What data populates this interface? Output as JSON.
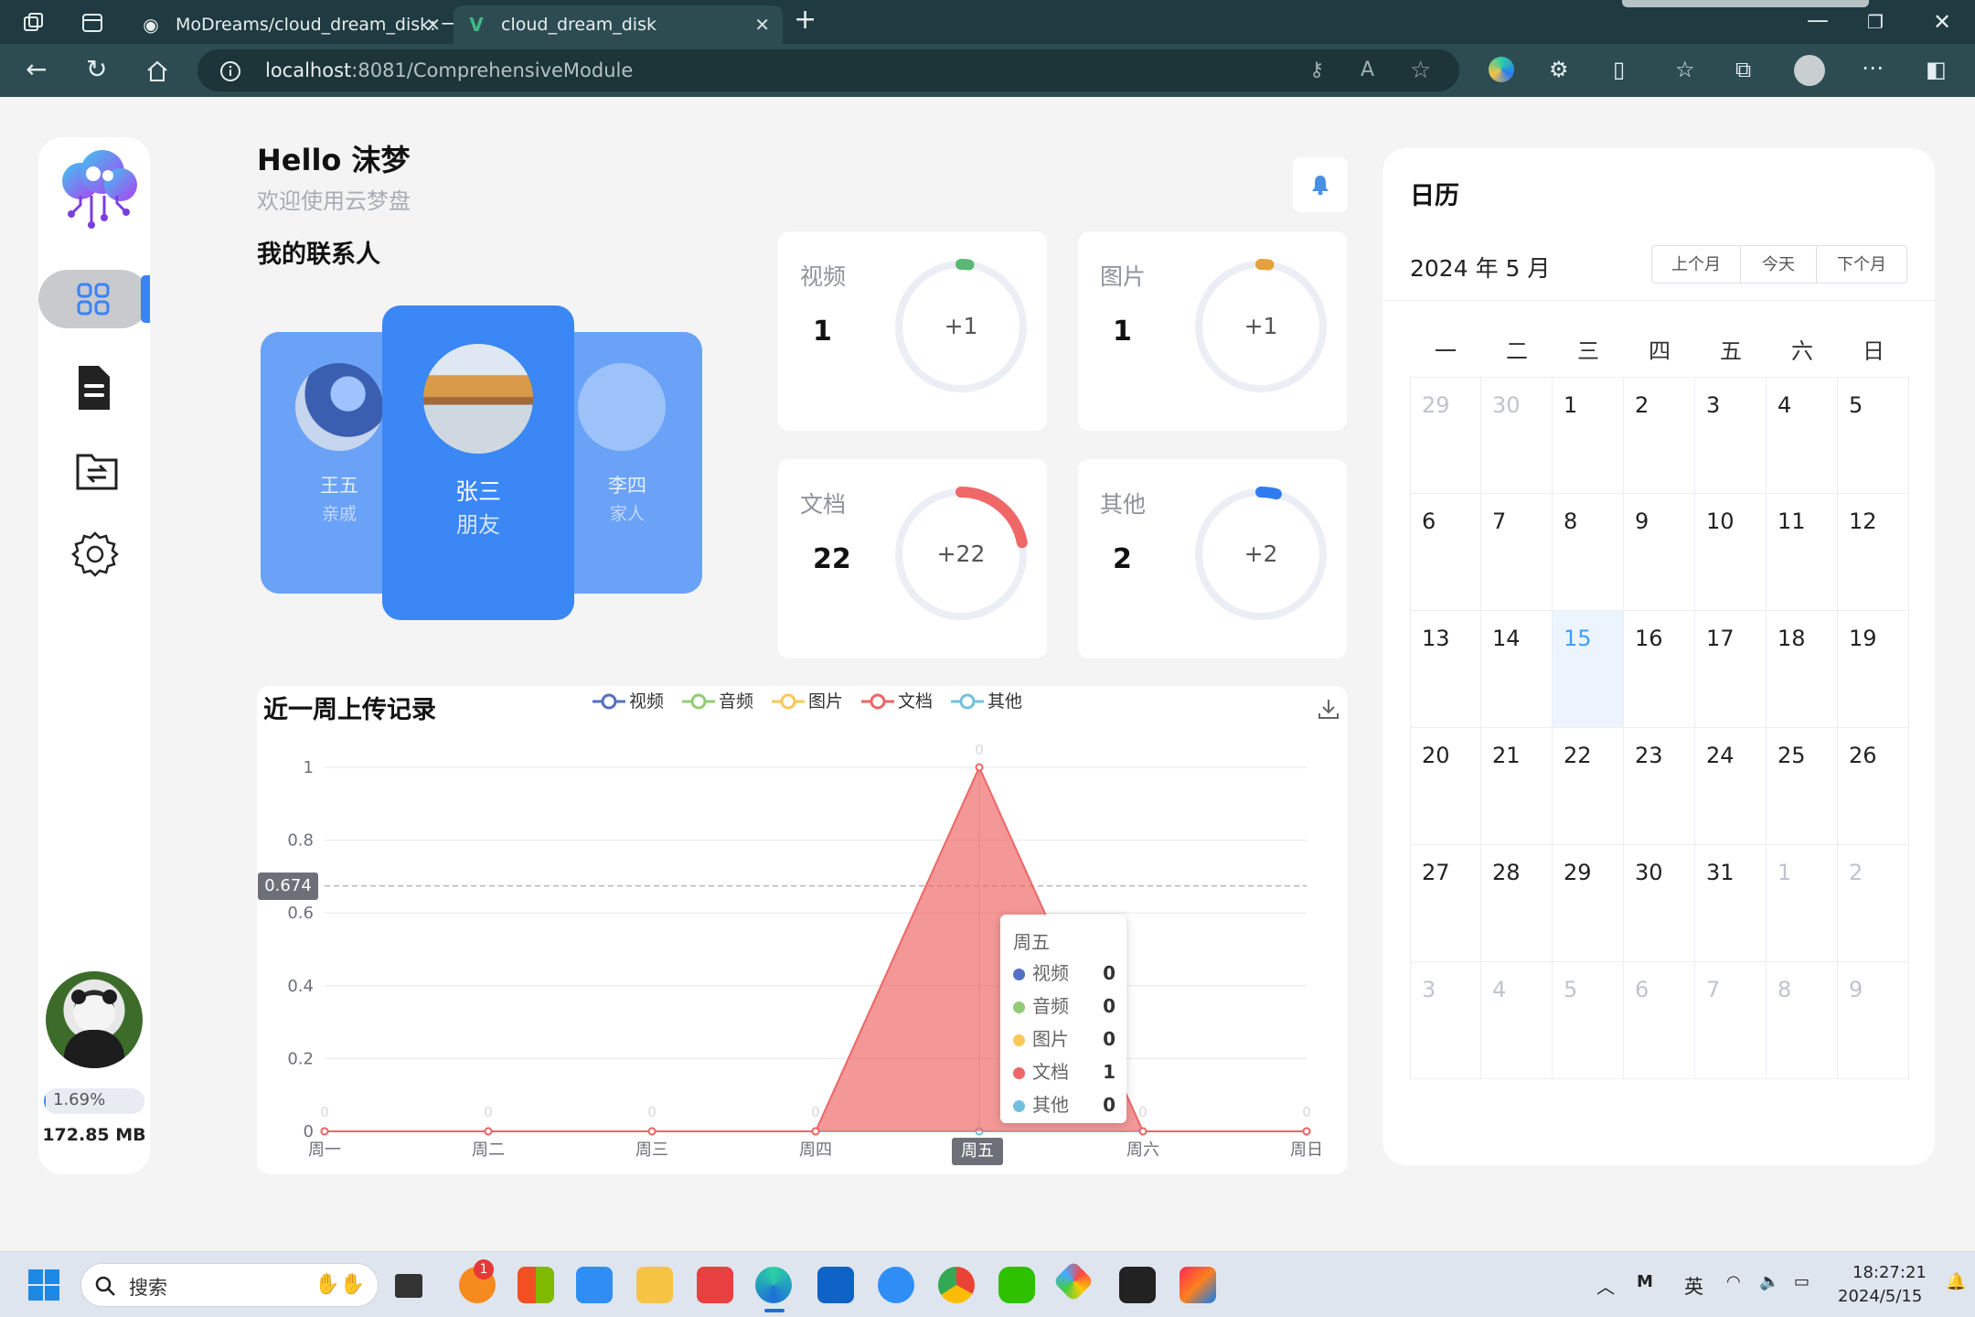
{
  "browser": {
    "tabs": [
      {
        "title": "MoDreams/cloud_dream_disk: 一",
        "active": false
      },
      {
        "title": "cloud_dream_disk",
        "active": true
      }
    ],
    "url_host": "localhost",
    "url_path": ":8081/ComprehensiveModule"
  },
  "header": {
    "greeting": "Hello 沫梦",
    "subtitle": "欢迎使用云梦盘"
  },
  "contacts": {
    "title": "我的联系人",
    "items": [
      {
        "name": "王五",
        "relation": "亲戚"
      },
      {
        "name": "张三",
        "relation": "朋友"
      },
      {
        "name": "李四",
        "relation": "家人"
      }
    ]
  },
  "stats": [
    {
      "label": "视频",
      "count": "1",
      "increment": "+1",
      "ratio": 0.02,
      "color": "#5ab874"
    },
    {
      "label": "图片",
      "count": "1",
      "increment": "+1",
      "ratio": 0.02,
      "color": "#e5a23c"
    },
    {
      "label": "文档",
      "count": "22",
      "increment": "+22",
      "ratio": 0.22,
      "color": "#ef6767"
    },
    {
      "label": "其他",
      "count": "2",
      "increment": "+2",
      "ratio": 0.04,
      "color": "#2f7cf0"
    }
  ],
  "sidebar": {
    "storage_percent": "1.69%",
    "storage_used": "172.85 MB",
    "storage_ratio": 0.0169
  },
  "chart_data": {
    "type": "area",
    "title": "近一周上传记录",
    "categories": [
      "周一",
      "周二",
      "周三",
      "周四",
      "周五",
      "周六",
      "周日"
    ],
    "y_ticks": [
      "0",
      "0.2",
      "0.4",
      "0.6",
      "0.8",
      "1"
    ],
    "ylim": [
      0,
      1
    ],
    "series": [
      {
        "name": "视频",
        "color": "#5470c6",
        "values": [
          0,
          0,
          0,
          0,
          0,
          0,
          0
        ]
      },
      {
        "name": "音频",
        "color": "#91cc75",
        "values": [
          0,
          0,
          0,
          0,
          0,
          0,
          0
        ]
      },
      {
        "name": "图片",
        "color": "#fac858",
        "values": [
          0,
          0,
          0,
          0,
          0,
          0,
          0
        ]
      },
      {
        "name": "文档",
        "color": "#ee6666",
        "values": [
          0,
          0,
          0,
          0,
          1,
          0,
          0
        ]
      },
      {
        "name": "其他",
        "color": "#73c0de",
        "values": [
          0,
          0,
          0,
          0,
          0,
          0,
          0
        ]
      }
    ],
    "data_labels": [
      "0",
      "0",
      "0",
      "0",
      "0",
      "0",
      "0"
    ],
    "crosshair_y": "0.674",
    "crosshair_x": "周五",
    "tooltip": {
      "title": "周五",
      "rows": [
        {
          "name": "视频",
          "value": "0",
          "color": "#5470c6"
        },
        {
          "name": "音频",
          "value": "0",
          "color": "#91cc75"
        },
        {
          "name": "图片",
          "value": "0",
          "color": "#fac858"
        },
        {
          "name": "文档",
          "value": "1",
          "color": "#ee6666"
        },
        {
          "name": "其他",
          "value": "0",
          "color": "#73c0de"
        }
      ]
    },
    "grid": true,
    "legend_position": "top"
  },
  "calendar": {
    "title": "日历",
    "month_label": "2024 年 5 月",
    "buttons": [
      "上个月",
      "今天",
      "下个月"
    ],
    "weekdays": [
      "一",
      "二",
      "三",
      "四",
      "五",
      "六",
      "日"
    ],
    "days": [
      [
        "29",
        "30",
        "1",
        "2",
        "3",
        "4",
        "5"
      ],
      [
        "6",
        "7",
        "8",
        "9",
        "10",
        "11",
        "12"
      ],
      [
        "13",
        "14",
        "15",
        "16",
        "17",
        "18",
        "19"
      ],
      [
        "20",
        "21",
        "22",
        "23",
        "24",
        "25",
        "26"
      ],
      [
        "27",
        "28",
        "29",
        "30",
        "31",
        "1",
        "2"
      ],
      [
        "3",
        "4",
        "5",
        "6",
        "7",
        "8",
        "9"
      ]
    ],
    "today": "15"
  },
  "taskbar": {
    "search_placeholder": "搜索",
    "time": "18:27:21",
    "date": "2024/5/15",
    "ime": "英",
    "badge": "1"
  }
}
